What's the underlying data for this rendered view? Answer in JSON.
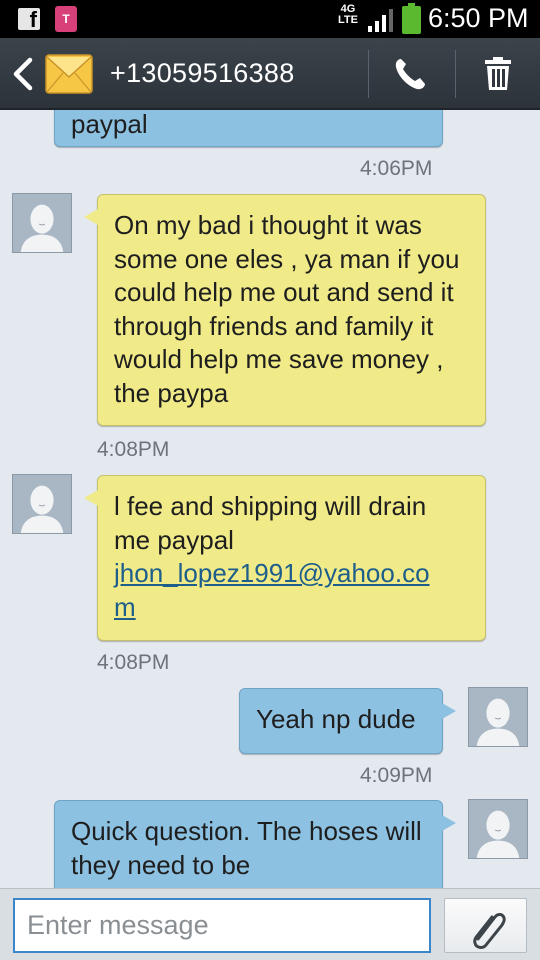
{
  "status_bar": {
    "time": "6:50 PM",
    "network": "4G LTE",
    "facebook_icon": "facebook-icon",
    "tmobile_icon": "tmobile-icon",
    "battery_color": "#5ab92e"
  },
  "header": {
    "contact": "+13059516388",
    "back_icon": "back-chevron-icon",
    "message_icon": "envelope-icon",
    "call_icon": "phone-icon",
    "delete_icon": "trash-icon"
  },
  "messages": [
    {
      "direction": "outgoing",
      "text": "paypal",
      "time": "4:06PM"
    },
    {
      "direction": "incoming",
      "text": "On my bad i thought it was some one eles , ya man if you could help me out and send it through friends and family it would help me save money , the paypa",
      "time": "4:08PM"
    },
    {
      "direction": "incoming",
      "text": "l fee and shipping will drain me paypal",
      "email": "jhon_lopez1991@yahoo.co",
      "email_end": "m",
      "time": "4:08PM"
    },
    {
      "direction": "outgoing",
      "text": "Yeah np dude",
      "time": "4:09PM"
    },
    {
      "direction": "outgoing",
      "text": "Quick question. The hoses will they need to be",
      "time": ""
    }
  ],
  "composer": {
    "placeholder": "Enter message",
    "attach_icon": "paperclip-icon"
  },
  "colors": {
    "outgoing_bubble": "#8dc1e2",
    "incoming_bubble": "#f0eb88",
    "header_bg": "#333a41",
    "background": "#e3e9ef"
  }
}
